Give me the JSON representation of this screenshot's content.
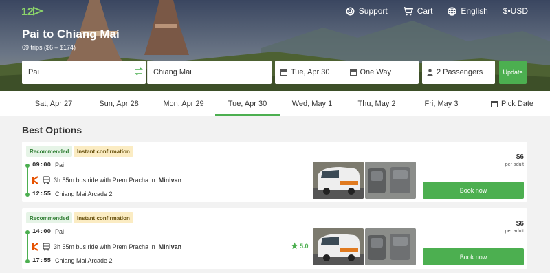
{
  "brand": {
    "logo_text": "12go",
    "accent": "#4caf50"
  },
  "nav": {
    "support": "Support",
    "cart": "Cart",
    "language": "English",
    "currency": "$•USD"
  },
  "route": {
    "title": "Pai to Chiang Mai",
    "subtitle": "69 trips ($6 – $174)"
  },
  "search": {
    "from": "Pai",
    "to": "Chiang Mai",
    "date": "Tue, Apr 30",
    "trip_type": "One Way",
    "passengers": "2 Passengers",
    "update_label": "Update"
  },
  "date_tabs": [
    {
      "label": "Sat, Apr 27"
    },
    {
      "label": "Sun, Apr 28"
    },
    {
      "label": "Mon, Apr 29"
    },
    {
      "label": "Tue, Apr 30",
      "active": true
    },
    {
      "label": "Wed, May 1"
    },
    {
      "label": "Thu, May 2"
    },
    {
      "label": "Fri, May 3"
    }
  ],
  "pick_date": "Pick Date",
  "section_title": "Best Options",
  "trips": [
    {
      "badges": [
        "Recommended",
        "Instant confirmation"
      ],
      "depart_time": "09:00",
      "depart_place": "Pai",
      "ride_text": "3h 55m bus ride with Prem Pracha in",
      "vehicle": "Minivan",
      "arrive_time": "12:55",
      "arrive_place": "Chiang Mai Arcade 2",
      "rating": "",
      "price": "$6",
      "per": "per adult",
      "book_label": "Book now"
    },
    {
      "badges": [
        "Recommended",
        "Instant confirmation"
      ],
      "depart_time": "14:00",
      "depart_place": "Pai",
      "ride_text": "3h 55m bus ride with Prem Pracha in",
      "vehicle": "Minivan",
      "arrive_time": "17:55",
      "arrive_place": "Chiang Mai Arcade 2",
      "rating": "5.0",
      "price": "$6",
      "per": "per adult",
      "book_label": "Book now"
    }
  ]
}
